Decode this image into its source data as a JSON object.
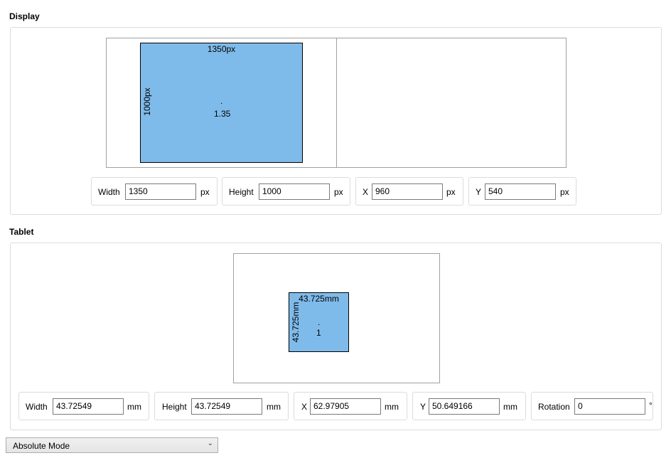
{
  "display": {
    "title": "Display",
    "area": {
      "width_label": "1350px",
      "height_label": "1000px",
      "center_marker": ".",
      "aspect": "1.35"
    },
    "fields": {
      "width": {
        "label": "Width",
        "value": "1350",
        "unit": "px"
      },
      "height": {
        "label": "Height",
        "value": "1000",
        "unit": "px"
      },
      "x": {
        "label": "X",
        "value": "960",
        "unit": "px"
      },
      "y": {
        "label": "Y",
        "value": "540",
        "unit": "px"
      }
    }
  },
  "tablet": {
    "title": "Tablet",
    "area": {
      "width_label": "43.725mm",
      "height_label": "43.725mm",
      "center_marker": ".",
      "aspect": "1"
    },
    "fields": {
      "width": {
        "label": "Width",
        "value": "43.72549",
        "unit": "mm"
      },
      "height": {
        "label": "Height",
        "value": "43.72549",
        "unit": "mm"
      },
      "x": {
        "label": "X",
        "value": "62.97905",
        "unit": "mm"
      },
      "y": {
        "label": "Y",
        "value": "50.649166",
        "unit": "mm"
      },
      "rotation": {
        "label": "Rotation",
        "value": "0",
        "unit": "°"
      }
    }
  },
  "mode_select": {
    "value": "Absolute Mode",
    "icon": "chevron-down-icon"
  },
  "colors": {
    "area_fill": "#7fbbea",
    "border": "#dcdcdc"
  }
}
